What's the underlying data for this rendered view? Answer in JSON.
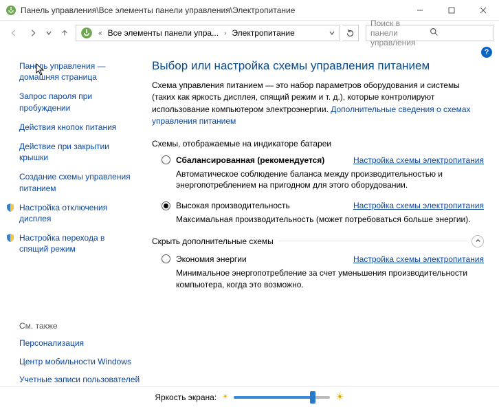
{
  "titlebar": {
    "path": "Панель управления\\Все элементы панели управления\\Электропитание"
  },
  "breadcrumb": {
    "item1": "Все элементы панели упра...",
    "item2": "Электропитание"
  },
  "search": {
    "placeholder": "Поиск в панели управления"
  },
  "sidebar": {
    "links": [
      "Панель управления — домашняя страница",
      "Запрос пароля при пробуждении",
      "Действия кнопок питания",
      "Действие при закрытии крышки",
      "Создание схемы управления питанием",
      "Настройка отключения дисплея",
      "Настройка перехода в спящий режим"
    ]
  },
  "main": {
    "heading": "Выбор или настройка схемы управления питанием",
    "intro_plain": "Схема управления питанием — это набор параметров оборудования и системы (таких как яркость дисплея, спящий режим и т. д.), которые контролируют использование компьютером электроэнергии. ",
    "intro_link": "Дополнительные сведения о схемах управления питанием",
    "section_shown": "Схемы, отображаемые на индикаторе батареи",
    "section_hidden": "Скрыть дополнительные схемы",
    "plan_link": "Настройка схемы электропитания",
    "plans": {
      "balanced": {
        "name": "Сбалансированная (рекомендуется)",
        "desc": "Автоматическое соблюдение баланса между производительностью и энергопотреблением на пригодном для этого оборудовании.",
        "selected": false
      },
      "high": {
        "name": "Высокая производительность",
        "desc": "Максимальная производительность (может потребоваться больше энергии).",
        "selected": true
      },
      "saver": {
        "name": "Экономия энергии",
        "desc": "Минимальное энергопотребление за счет уменьшения производительности компьютера, когда это возможно.",
        "selected": false
      }
    }
  },
  "seealso": {
    "header": "См. также",
    "links": [
      "Персонализация",
      "Центр мобильности Windows",
      "Учетные записи пользователей"
    ]
  },
  "footer": {
    "brightness_label": "Яркость экрана:",
    "brightness_value": 82
  }
}
